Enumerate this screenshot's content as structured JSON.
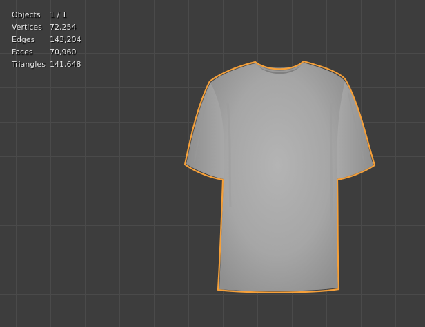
{
  "viewport": {
    "background": "#3d3d3d",
    "grid_color": "#4a4a4a",
    "axis_color": "#4e6ea8",
    "selection_outline_color": "#f5a03a",
    "mesh_color": "#a9a9a9"
  },
  "stats": {
    "objects": {
      "label": "Objects",
      "value": "1 / 1"
    },
    "vertices": {
      "label": "Vertices",
      "value": "72,254"
    },
    "edges": {
      "label": "Edges",
      "value": "143,204"
    },
    "faces": {
      "label": "Faces",
      "value": "70,960"
    },
    "triangles": {
      "label": "Triangles",
      "value": "141,648"
    }
  },
  "scene": {
    "selected_object_icon": "tshirt-mesh"
  }
}
